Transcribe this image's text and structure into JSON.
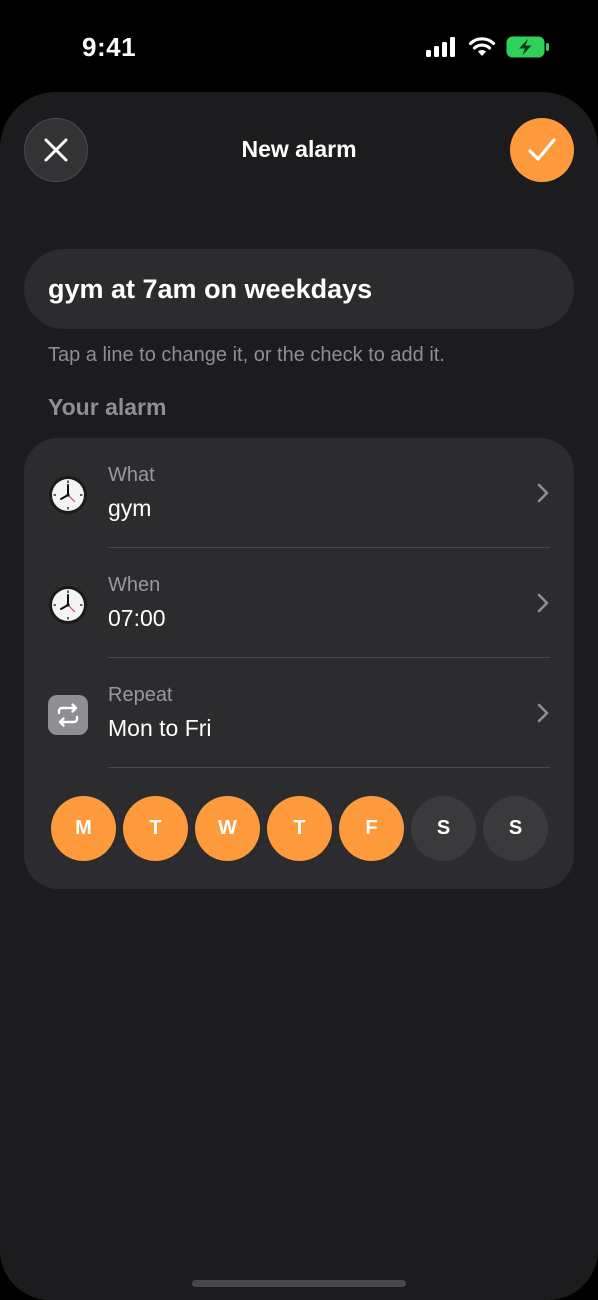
{
  "status_bar": {
    "time": "9:41",
    "signal_icon": "cellular-signal-icon",
    "wifi_icon": "wifi-icon",
    "battery_icon": "battery-charging-icon",
    "battery_color": "#30d158"
  },
  "header": {
    "title": "New alarm",
    "close_icon": "close-icon",
    "confirm_icon": "checkmark-icon",
    "accent_color": "#ff9a3c"
  },
  "query": {
    "value": "gym at 7am on weekdays"
  },
  "hint": "Tap a line to change it, or the check to add it.",
  "section_title": "Your alarm",
  "rows": [
    {
      "label": "What",
      "value": "gym",
      "icon": "clock-icon"
    },
    {
      "label": "When",
      "value": "07:00",
      "icon": "clock-icon"
    },
    {
      "label": "Repeat",
      "value": "Mon to Fri",
      "icon": "repeat-icon"
    }
  ],
  "days": [
    {
      "letter": "M",
      "selected": true
    },
    {
      "letter": "T",
      "selected": true
    },
    {
      "letter": "W",
      "selected": true
    },
    {
      "letter": "T",
      "selected": true
    },
    {
      "letter": "F",
      "selected": true
    },
    {
      "letter": "S",
      "selected": false
    },
    {
      "letter": "S",
      "selected": false
    }
  ]
}
